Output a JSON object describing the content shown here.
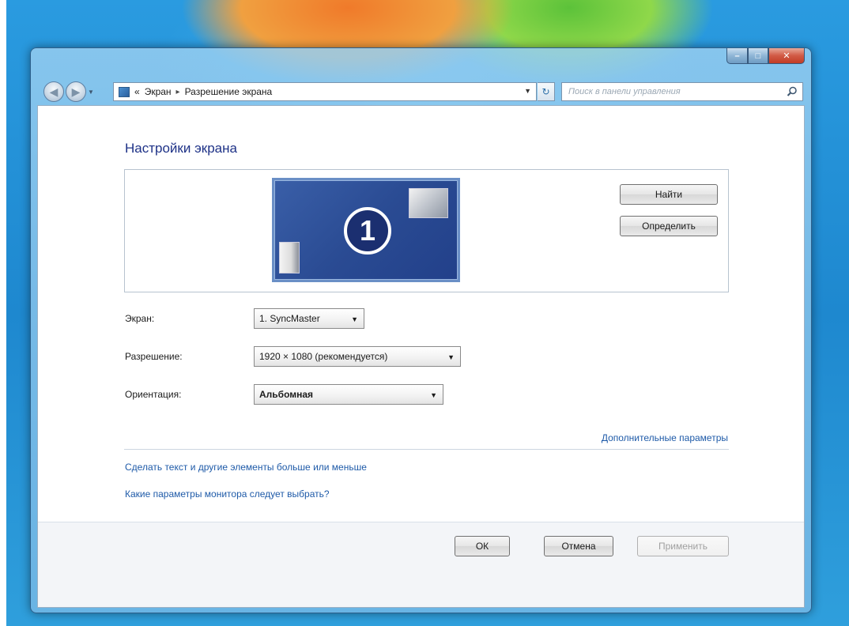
{
  "window": {
    "controls": {
      "minimize": "–",
      "maximize": "□",
      "close": "✕"
    }
  },
  "navbar": {
    "back_icon": "back-arrow-icon",
    "forward_icon": "forward-arrow-icon",
    "breadcrumb": [
      "Экран",
      "Разрешение экрана"
    ],
    "breadcrumb_prefix": "«",
    "breadcrumb_separator": "▸",
    "search_placeholder": "Поиск в панели управления"
  },
  "main": {
    "title": "Настройки экрана",
    "monitor_number": "1",
    "find_button": "Найти",
    "identify_button": "Определить",
    "fields": {
      "screen_label": "Экран:",
      "screen_value": "1. SyncMaster",
      "resolution_label": "Разрешение:",
      "resolution_value": "1920 × 1080 (рекомендуется)",
      "orientation_label": "Ориентация:",
      "orientation_value": "Альбомная"
    },
    "links": {
      "advanced": "Дополнительные параметры",
      "text_size": "Сделать текст и другие элементы больше или меньше",
      "which_settings": "Какие параметры монитора следует выбрать?"
    }
  },
  "footer": {
    "ok": "ОК",
    "cancel": "Отмена",
    "apply": "Применить"
  },
  "colors": {
    "title": "#1e3287",
    "link": "#1e5aa8",
    "monitor": "#2a4b93"
  }
}
